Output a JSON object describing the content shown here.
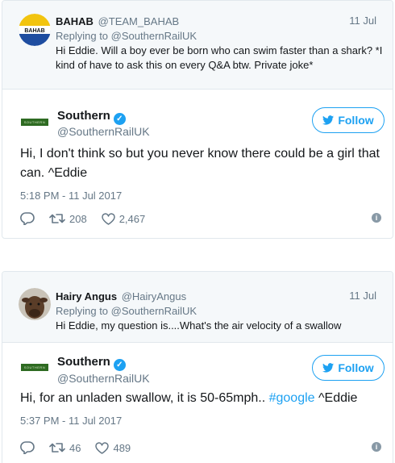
{
  "colors": {
    "link": "#1da1f2",
    "muted": "#657786",
    "border": "#e1e8ed",
    "reply_bg": "#f5f8fa"
  },
  "tweets": [
    {
      "reply": {
        "name": "BAHAB",
        "handle": "@TEAM_BAHAB",
        "date": "11 Jul",
        "replying_prefix": "Replying to",
        "replying_to": "@SouthernRailUK",
        "text": "Hi Eddie. Will a boy ever be born who can swim faster than a shark? *I kind of have to ask this on every Q&A btw. Private joke*",
        "avatar_text": "BAHAB"
      },
      "main": {
        "name": "Southern",
        "handle": "@SouthernRailUK",
        "follow_label": "Follow",
        "text": "Hi, I don't think so but you never know there could be a girl that can. ^Eddie",
        "timestamp": "5:18 PM - 11 Jul 2017",
        "retweets": "208",
        "likes": "2,467",
        "logo_text": "SOUTHERN"
      }
    },
    {
      "reply": {
        "name": "Hairy Angus",
        "handle": "@HairyAngus",
        "date": "11 Jul",
        "replying_prefix": "Replying to",
        "replying_to": "@SouthernRailUK",
        "text": "Hi Eddie, my question is....What's the air velocity of a swallow"
      },
      "main": {
        "name": "Southern",
        "handle": "@SouthernRailUK",
        "follow_label": "Follow",
        "text_before": "Hi, for an unladen swallow, it is 50-65mph..",
        "hashtag": "#google",
        "text_after": "^Eddie",
        "timestamp": "5:37 PM - 11 Jul 2017",
        "retweets": "46",
        "likes": "489",
        "logo_text": "SOUTHERN"
      }
    }
  ]
}
